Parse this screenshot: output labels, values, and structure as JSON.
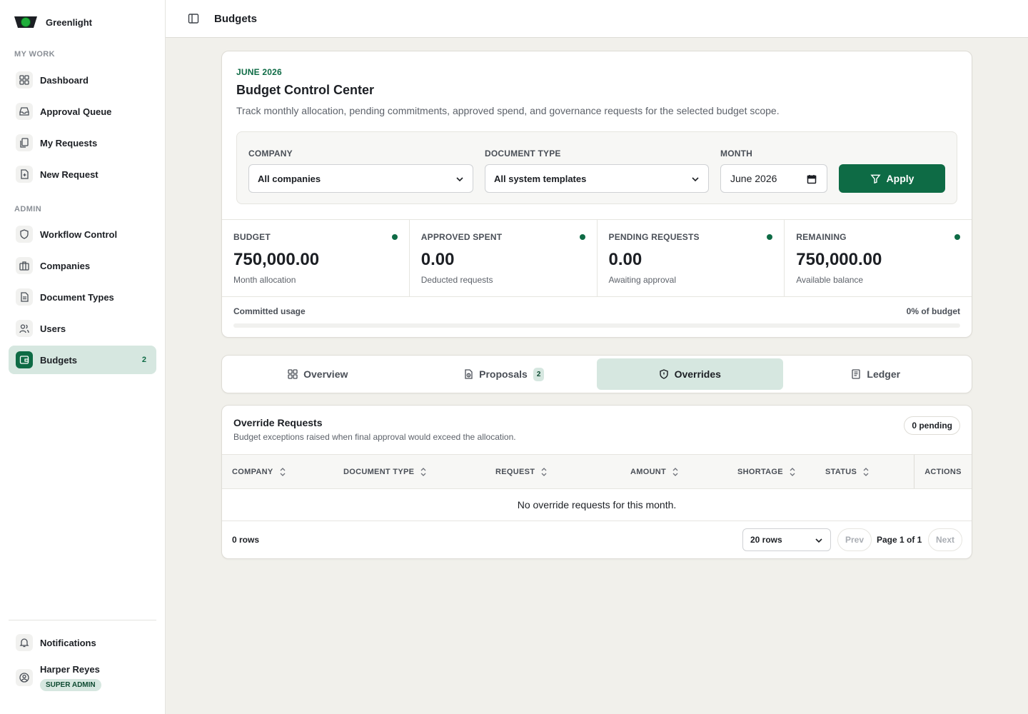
{
  "brand": {
    "name": "Greenlight"
  },
  "sidebar": {
    "my_work_label": "MY WORK",
    "admin_label": "ADMIN",
    "my_work": [
      {
        "label": "Dashboard",
        "icon": "grid-icon"
      },
      {
        "label": "Approval Queue",
        "icon": "inbox-icon"
      },
      {
        "label": "My Requests",
        "icon": "copy-icon"
      },
      {
        "label": "New Request",
        "icon": "file-plus-icon"
      }
    ],
    "admin": [
      {
        "label": "Workflow Control",
        "icon": "shield-icon"
      },
      {
        "label": "Companies",
        "icon": "briefcase-icon"
      },
      {
        "label": "Document Types",
        "icon": "document-icon"
      },
      {
        "label": "Users",
        "icon": "users-icon"
      },
      {
        "label": "Budgets",
        "icon": "wallet-icon",
        "badge": "2",
        "active": true
      }
    ],
    "notifications_label": "Notifications",
    "user": {
      "name": "Harper Reyes",
      "role": "SUPER ADMIN"
    }
  },
  "header": {
    "title": "Budgets"
  },
  "summary": {
    "eyebrow": "JUNE 2026",
    "title": "Budget Control Center",
    "description": "Track monthly allocation, pending commitments, approved spend, and governance requests for the selected budget scope.",
    "filters": {
      "company_label": "COMPANY",
      "company_value": "All companies",
      "doctype_label": "DOCUMENT TYPE",
      "doctype_value": "All system templates",
      "month_label": "MONTH",
      "month_value": "June 2026",
      "apply_label": "Apply"
    },
    "stats": [
      {
        "label": "BUDGET",
        "value": "750,000.00",
        "sub": "Month allocation"
      },
      {
        "label": "APPROVED SPENT",
        "value": "0.00",
        "sub": "Deducted requests"
      },
      {
        "label": "PENDING REQUESTS",
        "value": "0.00",
        "sub": "Awaiting approval"
      },
      {
        "label": "REMAINING",
        "value": "750,000.00",
        "sub": "Available balance"
      }
    ],
    "usage": {
      "label": "Committed usage",
      "pct_text": "0% of budget",
      "fraction": 0
    }
  },
  "tabs": [
    {
      "label": "Overview",
      "icon": "grid-icon"
    },
    {
      "label": "Proposals",
      "icon": "file-clock-icon",
      "badge": "2"
    },
    {
      "label": "Overrides",
      "icon": "shield-icon",
      "active": true
    },
    {
      "label": "Ledger",
      "icon": "ledger-icon"
    }
  ],
  "overrides": {
    "title": "Override Requests",
    "description": "Budget exceptions raised when final approval would exceed the allocation.",
    "pending_badge": "0 pending",
    "columns": [
      "COMPANY",
      "DOCUMENT TYPE",
      "REQUEST",
      "AMOUNT",
      "SHORTAGE",
      "STATUS"
    ],
    "actions_label": "ACTIONS",
    "empty_text": "No override requests for this month.",
    "row_count": "0 rows",
    "rows_per_page": "20 rows",
    "prev_label": "Prev",
    "page_info": "Page 1 of 1",
    "next_label": "Next"
  },
  "colors": {
    "accent": "#0e6b45",
    "accent_soft": "#d6e7e0",
    "background": "#f1f0eb"
  }
}
